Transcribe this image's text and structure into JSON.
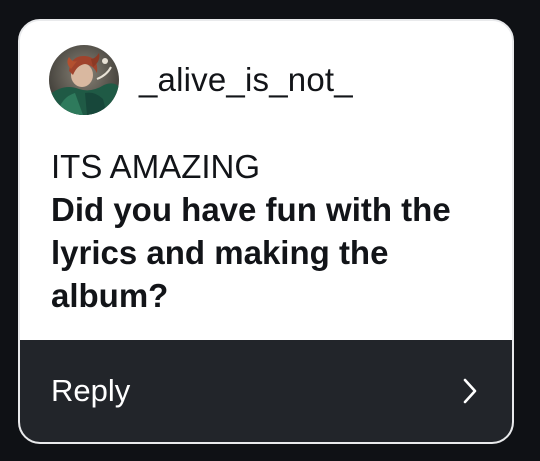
{
  "post": {
    "username": "_alive_is_not_",
    "avatar_icon": "profile-avatar-icon",
    "message_line1": "ITS AMAZING",
    "message_line2": "Did you have fun with the lyrics and making the album?"
  },
  "reply": {
    "label": "Reply",
    "icon": "chevron-right-icon"
  },
  "colors": {
    "background": "#0f1115",
    "card": "#ffffff",
    "reply_bar": "#22252a",
    "text": "#121418"
  }
}
